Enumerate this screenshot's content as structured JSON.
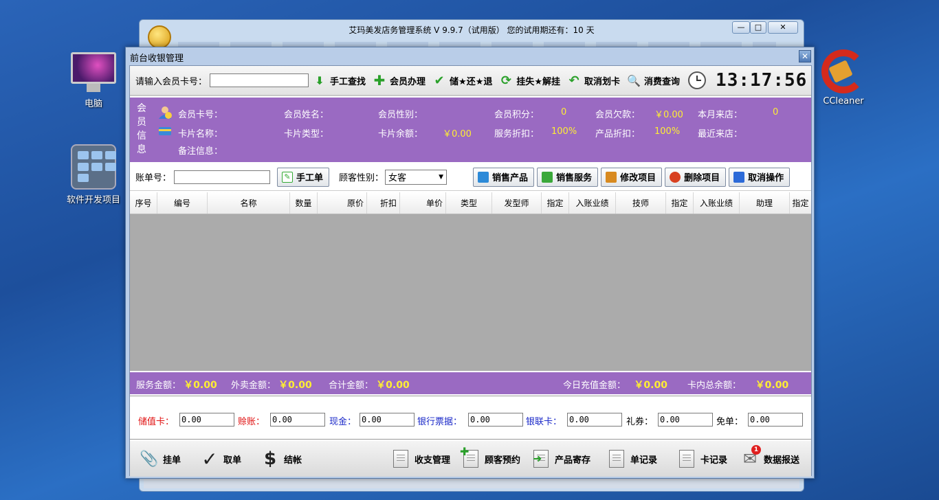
{
  "desktop": {
    "icons": [
      {
        "label": "电脑"
      },
      {
        "label": "软件开发项目"
      },
      {
        "label": "CCleaner"
      }
    ]
  },
  "bg_window": {
    "title": "艾玛美发店务管理系统 V 9.9.7（试用版）   您的试用期还有：10 天",
    "controls": [
      "—",
      "□",
      "✕"
    ]
  },
  "dialog": {
    "title": "前台收银管理",
    "close": "✕"
  },
  "toolbar": {
    "card_label": "请输入会员卡号：",
    "card_value": "",
    "buttons": [
      {
        "label": "手工查找",
        "icon": "arrow-down-icon"
      },
      {
        "label": "会员办理",
        "icon": "plus-icon"
      },
      {
        "label": "储★还★退",
        "icon": "check-icon"
      },
      {
        "label": "挂失★解挂",
        "icon": "refresh-icon"
      },
      {
        "label": "取消划卡",
        "icon": "undo-icon"
      },
      {
        "label": "消费查询",
        "icon": "search-plus-icon"
      }
    ],
    "clock": "13:17:56"
  },
  "member": {
    "side_label": [
      "会",
      "员",
      "信",
      "息"
    ],
    "fields": {
      "card_no": {
        "label": "会员卡号：",
        "value": ""
      },
      "name": {
        "label": "会员姓名：",
        "value": ""
      },
      "gender": {
        "label": "会员性别：",
        "value": ""
      },
      "points": {
        "label": "会员积分：",
        "value": "0"
      },
      "debt": {
        "label": "会员欠款：",
        "value": "￥0.00"
      },
      "visits_month": {
        "label": "本月来店：",
        "value": "0"
      },
      "card_name": {
        "label": "卡片名称：",
        "value": ""
      },
      "card_type": {
        "label": "卡片类型：",
        "value": ""
      },
      "card_balance": {
        "label": "卡片余额：",
        "value": "￥0.00"
      },
      "service_discount": {
        "label": "服务折扣：",
        "value": "100%"
      },
      "product_discount": {
        "label": "产品折扣：",
        "value": "100%"
      },
      "last_visit": {
        "label": "最近来店：",
        "value": ""
      },
      "remarks": {
        "label": "备注信息：",
        "value": ""
      }
    }
  },
  "bill": {
    "bill_no_label": "账单号：",
    "bill_no_value": "",
    "manual_button": "手工单",
    "gender_label": "顾客性别：",
    "gender_value": "女客",
    "actions": [
      {
        "label": "销售产品",
        "color": "#2c8ad8"
      },
      {
        "label": "销售服务",
        "color": "#3aa83a"
      },
      {
        "label": "修改项目",
        "color": "#d88a20"
      },
      {
        "label": "删除项目",
        "color": "#d84020"
      },
      {
        "label": "取消操作",
        "color": "#2c6ad8"
      }
    ]
  },
  "table": {
    "columns": [
      "序号",
      "编号",
      "名称",
      "数量",
      "原价",
      "折扣",
      "单价",
      "类型",
      "发型师",
      "指定",
      "入账业绩",
      "技师",
      "指定",
      "入账业绩",
      "助理",
      "指定"
    ],
    "rows": []
  },
  "sums": {
    "service_label": "服务金额：",
    "service_value": "￥0.00",
    "takeout_label": "外卖金额：",
    "takeout_value": "￥0.00",
    "total_label": "合计金额：",
    "total_value": "￥0.00",
    "recharge_label": "今日充值金额：",
    "recharge_value": "￥0.00",
    "card_total_label": "卡内总余额：",
    "card_total_value": "￥0.00"
  },
  "payment": [
    {
      "label": "储值卡：",
      "value": "0.00",
      "color": "red"
    },
    {
      "label": "赊账：",
      "value": "0.00",
      "color": "red"
    },
    {
      "label": "现金：",
      "value": "0.00",
      "color": "blue"
    },
    {
      "label": "银行票据：",
      "value": "0.00",
      "color": "blue"
    },
    {
      "label": "银联卡：",
      "value": "0.00",
      "color": "blue"
    },
    {
      "label": "礼券：",
      "value": "0.00",
      "color": "black"
    },
    {
      "label": "免单：",
      "value": "0.00",
      "color": "black"
    }
  ],
  "bottom": {
    "hold": "挂单",
    "retrieve": "取单",
    "checkout": "结帐",
    "income": "收支管理",
    "appointment": "顾客预约",
    "storage": "产品寄存",
    "single_record": "单记录",
    "card_record": "卡记录",
    "report": "数据报送",
    "report_badge": "1"
  }
}
